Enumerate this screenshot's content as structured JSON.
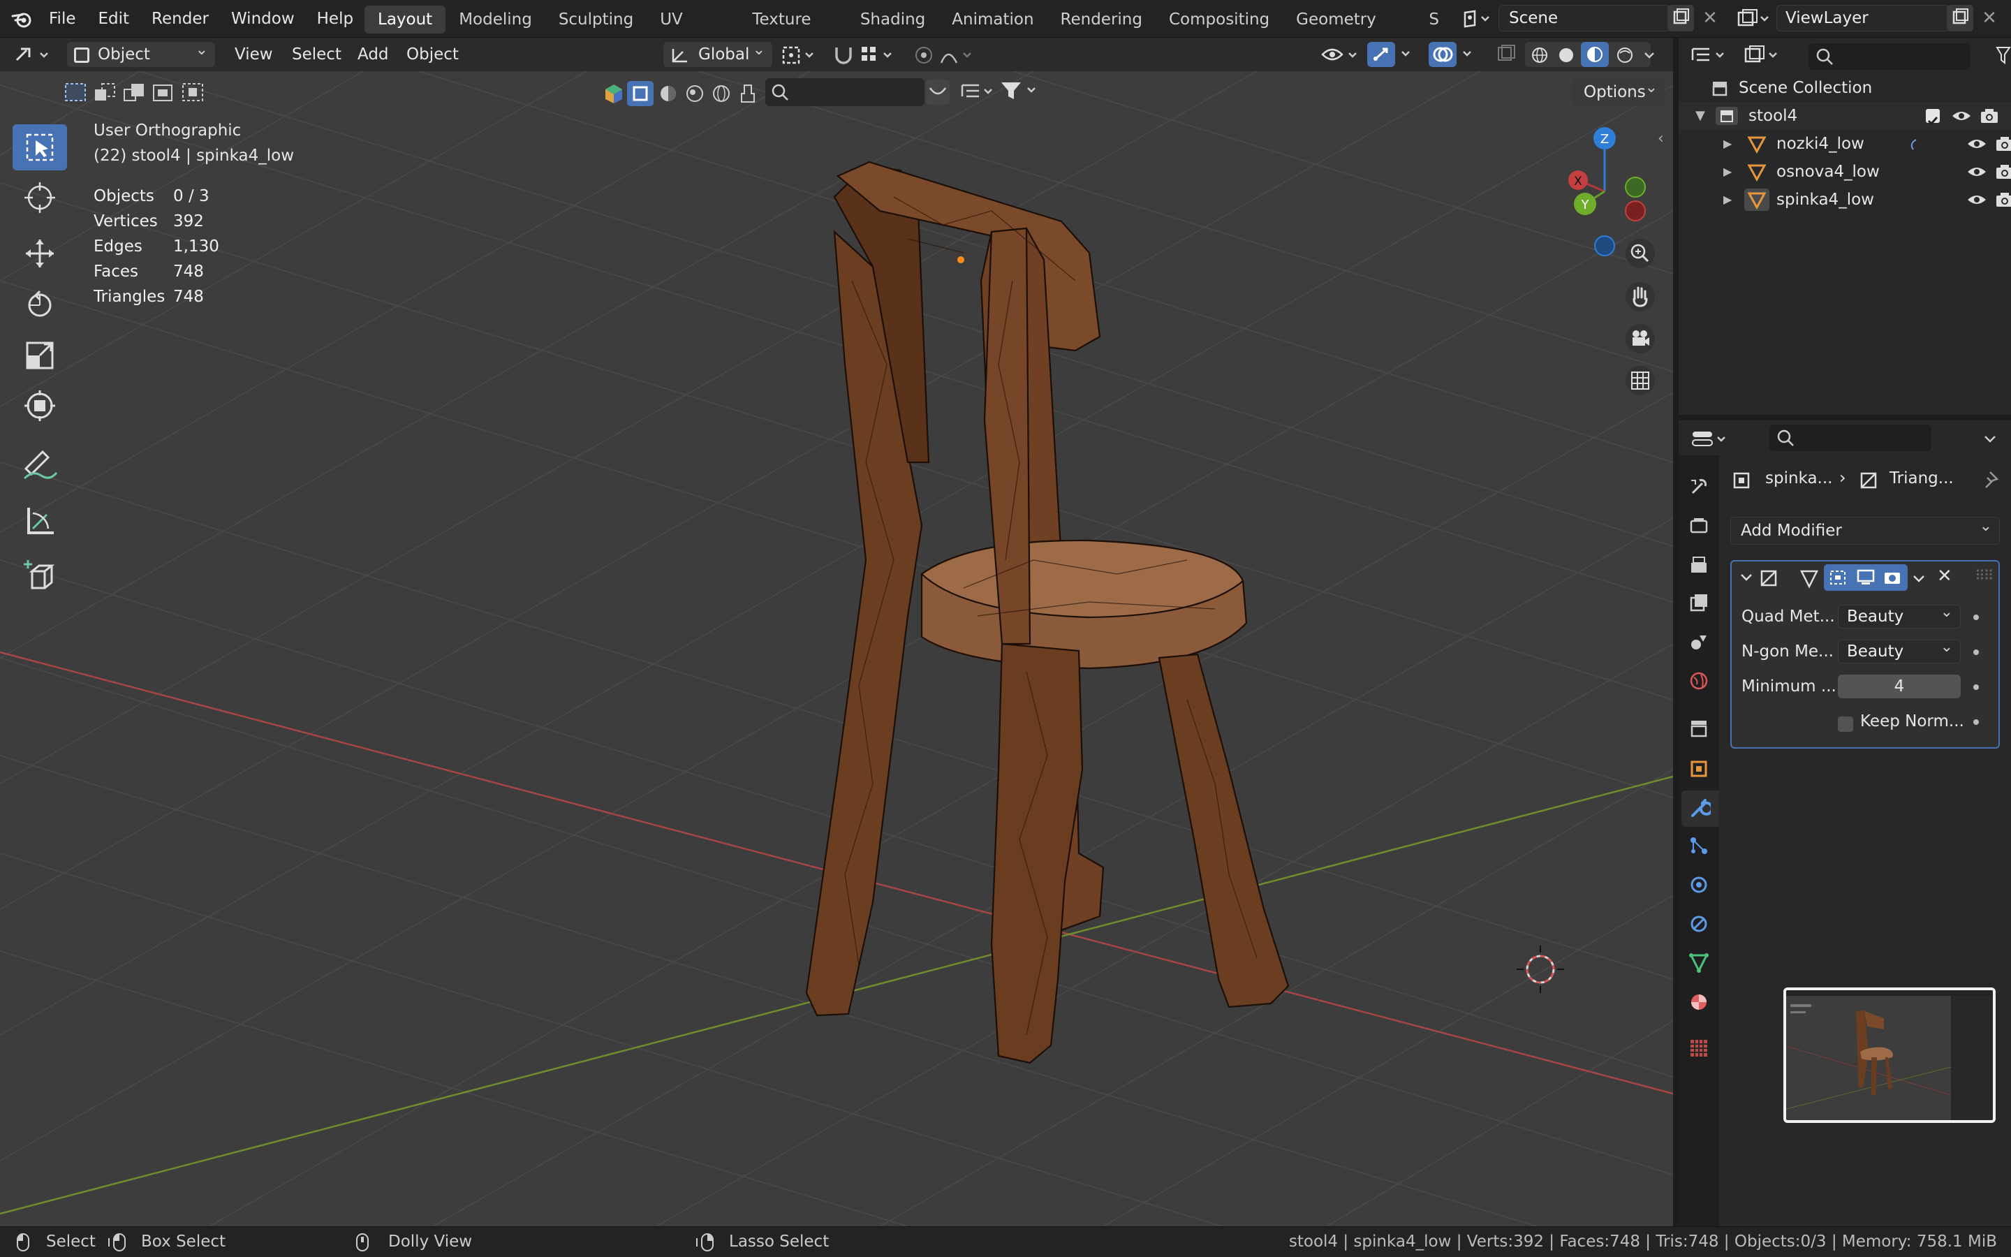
{
  "menubar": {
    "items": [
      "File",
      "Edit",
      "Render",
      "Window",
      "Help"
    ],
    "workspaces": [
      "Layout",
      "Modeling",
      "Sculpting",
      "UV Editing",
      "Texture Paint",
      "Shading",
      "Animation",
      "Rendering",
      "Compositing",
      "Geometry Nodes",
      "S"
    ],
    "active_workspace": "Layout",
    "scene": "Scene",
    "view_layer": "ViewLayer"
  },
  "viewport_header": {
    "mode": "Object Mode",
    "menus": [
      "View",
      "Select",
      "Add",
      "Object"
    ],
    "orientation": "Global",
    "options": "Options"
  },
  "overlay": {
    "view_name": "User Orthographic",
    "context": "(22) stool4 | spinka4_low",
    "stats": [
      {
        "label": "Objects",
        "value": "0 / 3"
      },
      {
        "label": "Vertices",
        "value": "392"
      },
      {
        "label": "Edges",
        "value": "1,130"
      },
      {
        "label": "Faces",
        "value": "748"
      },
      {
        "label": "Triangles",
        "value": "748"
      }
    ]
  },
  "gizmo": {
    "x": "X",
    "y": "Y",
    "z": "Z"
  },
  "outliner": {
    "root": "Scene Collection",
    "collection": "stool4",
    "objects": [
      "nozki4_low",
      "osnova4_low",
      "spinka4_low"
    ]
  },
  "properties": {
    "breadcrumb_object": "spinka...",
    "breadcrumb_modifier": "Triang...",
    "add_modifier": "Add Modifier",
    "modifier": {
      "rows": [
        {
          "label": "Quad Met...",
          "value": "Beauty"
        },
        {
          "label": "N-gon Me...",
          "value": "Beauty"
        }
      ],
      "min_label": "Minimum ...",
      "min_value": "4",
      "keep_normals": "Keep Norm..."
    }
  },
  "statusbar": {
    "select": "Select",
    "box_select": "Box Select",
    "dolly": "Dolly View",
    "lasso": "Lasso Select",
    "info": "stool4 | spinka4_low | Verts:392 | Faces:748 | Tris:748 | Objects:0/3 | Memory: 758.1 MiB"
  },
  "colors": {
    "accent": "#4772b3",
    "wood": "#6b3e22",
    "x_axis": "#b03a3a",
    "y_axis": "#6a8a2a",
    "z_axis": "#2f7fd8"
  }
}
